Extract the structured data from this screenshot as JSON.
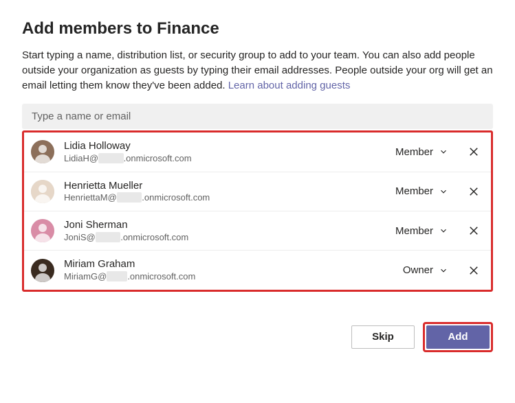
{
  "dialog": {
    "title": "Add members to Finance",
    "description_part1": "Start typing a name, distribution list, or security group to add to your team. You can also add people outside your organization as guests by typing their email addresses. People outside your org will get an email letting them know they've been added. ",
    "learn_link": "Learn about adding guests"
  },
  "search": {
    "placeholder": "Type a name or email"
  },
  "members": [
    {
      "name": "Lidia Holloway",
      "email_prefix": "LidiaH@",
      "email_masked": "xxxxx",
      "email_suffix": ".onmicrosoft.com",
      "role": "Member",
      "avatar_bg": "#8c6f5a"
    },
    {
      "name": "Henrietta Mueller",
      "email_prefix": "HenriettaM@",
      "email_masked": "xxxxx",
      "email_suffix": ".onmicrosoft.com",
      "role": "Member",
      "avatar_bg": "#e6d7c8"
    },
    {
      "name": "Joni Sherman",
      "email_prefix": "JoniS@",
      "email_masked": "xxxxx",
      "email_suffix": ".onmicrosoft.com",
      "role": "Member",
      "avatar_bg": "#d98ca6"
    },
    {
      "name": "Miriam Graham",
      "email_prefix": "MiriamG@",
      "email_masked": "xxxx",
      "email_suffix": ".onmicrosoft.com",
      "role": "Owner",
      "avatar_bg": "#3a2b20"
    }
  ],
  "buttons": {
    "skip": "Skip",
    "add": "Add"
  }
}
